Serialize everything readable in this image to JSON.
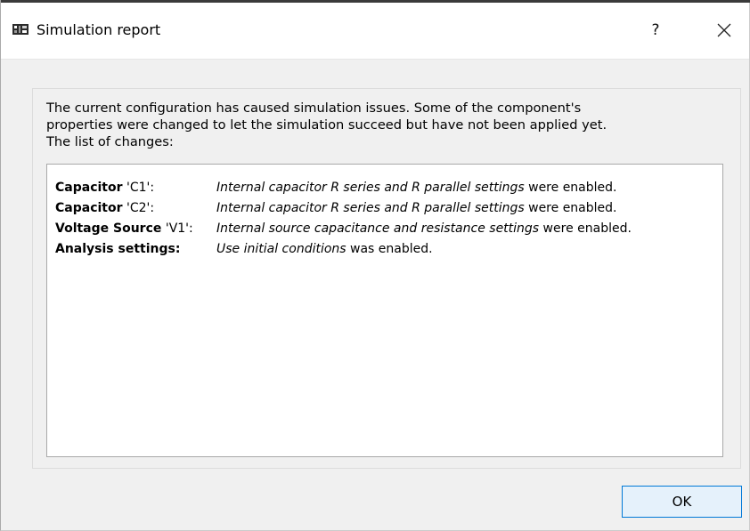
{
  "window": {
    "title": "Simulation report",
    "help_label": "?",
    "close_label": "×"
  },
  "message": "The current configuration has caused simulation issues. Some of the component's\nproperties were changed to let the simulation succeed but have not been applied yet.\nThe list of changes:",
  "changes": [
    {
      "subject_bold": "Capacitor",
      "subject_rest": " 'C1':",
      "detail_italic": "Internal capacitor R series and R parallel settings",
      "detail_rest": " were enabled."
    },
    {
      "subject_bold": "Capacitor",
      "subject_rest": " 'C2':",
      "detail_italic": "Internal capacitor R series and R parallel settings",
      "detail_rest": " were enabled."
    },
    {
      "subject_bold": "Voltage Source",
      "subject_rest": " 'V1':",
      "detail_italic": "Internal source capacitance and resistance settings",
      "detail_rest": " were enabled."
    },
    {
      "subject_bold": "Analysis settings:",
      "subject_rest": "",
      "detail_italic": "Use initial conditions",
      "detail_rest": " was enabled."
    }
  ],
  "buttons": {
    "ok_label": "OK"
  },
  "icons": {
    "app": "circuit-board-icon",
    "close": "close-icon"
  }
}
